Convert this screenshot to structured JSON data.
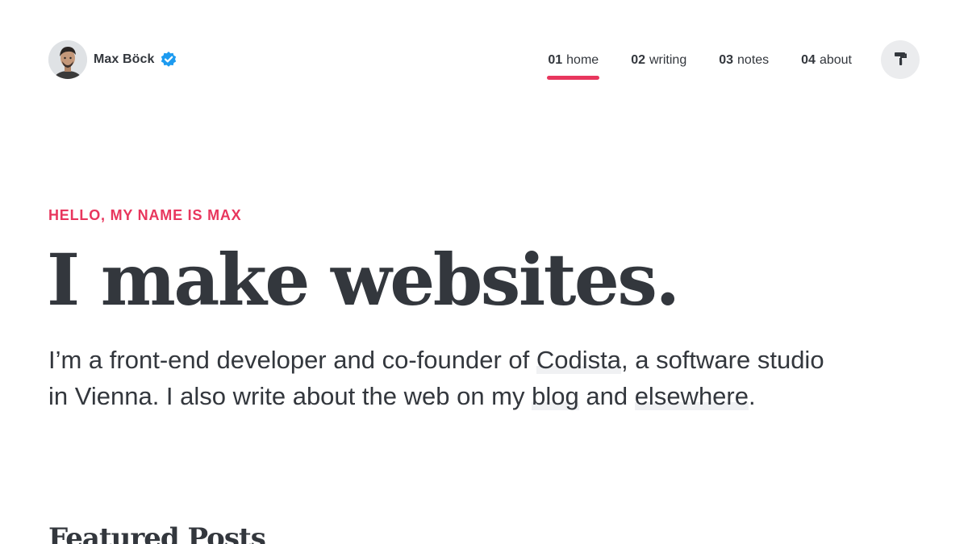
{
  "brand": {
    "name": "Max Böck",
    "avatar_icon": "avatar-photo",
    "verified_icon": "verified-badge-icon",
    "verified_color": "#1d9bf0"
  },
  "nav": {
    "items": [
      {
        "num": "01",
        "label": "home",
        "active": true
      },
      {
        "num": "02",
        "label": "writing",
        "active": false
      },
      {
        "num": "03",
        "label": "notes",
        "active": false
      },
      {
        "num": "04",
        "label": "about",
        "active": false
      }
    ],
    "active_color": "#e8365d",
    "theme_icon": "paint-roller-icon"
  },
  "hero": {
    "eyebrow": "HELLO, MY NAME IS MAX",
    "headline": "I make websites.",
    "intro": {
      "part1": "I’m a front-end developer and co-founder of ",
      "link1": "Codista",
      "part2": ", a software studio in Vienna. I also write about the web on my ",
      "link2": "blog",
      "part3": " and ",
      "link3": "elsewhere",
      "part4": "."
    }
  },
  "featured": {
    "title": "Featured Posts"
  },
  "colors": {
    "text": "#33373d",
    "accent": "#e8365d",
    "background": "#ffffff"
  }
}
